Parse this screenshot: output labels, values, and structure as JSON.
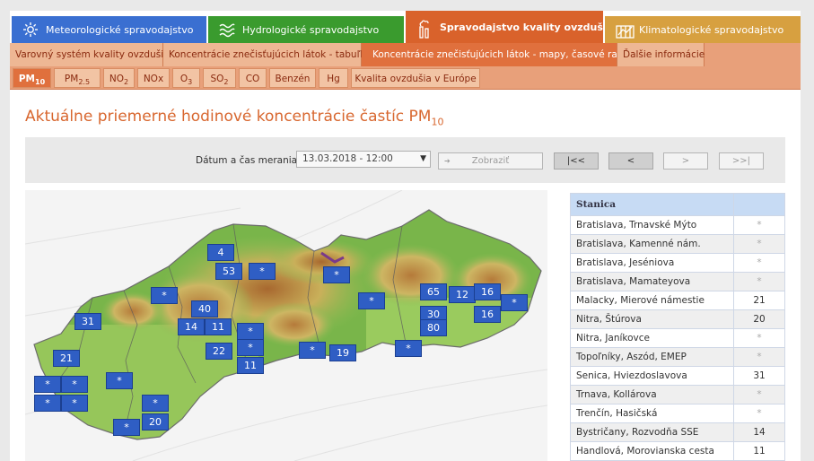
{
  "top_tabs": [
    {
      "label": "Meteorologické spravodajstvo",
      "color": "#3a6fd1",
      "icon": "sun-icon"
    },
    {
      "label": "Hydrologické spravodajstvo",
      "color": "#3a9b2e",
      "icon": "waves-icon"
    },
    {
      "label": "Spravodajstvo kvality ovzdušia",
      "color": "#d9622b",
      "icon": "smokestack-icon"
    },
    {
      "label": "Klimatologické spravodajstvo",
      "color": "#d7a040",
      "icon": "chart-icon"
    }
  ],
  "sub_nav": [
    {
      "label": "Varovný systém kvality ovzdušia"
    },
    {
      "label": "Koncentrácie znečisťujúcich látok - tabuľky"
    },
    {
      "label": "Koncentrácie znečisťujúcich látok - mapy, časové rady"
    },
    {
      "label": "Ďalšie informácie"
    }
  ],
  "pollutants": {
    "pm10": {
      "base": "PM",
      "sub": "10"
    },
    "pm25": {
      "base": "PM",
      "sub": "2.5"
    },
    "no2": {
      "base": "NO",
      "sub": "2"
    },
    "nox": {
      "base": "NOx"
    },
    "o3": {
      "base": "O",
      "sub": "3"
    },
    "so2": {
      "base": "SO",
      "sub": "2"
    },
    "co": {
      "base": "CO"
    },
    "benzen": {
      "base": "Benzén"
    },
    "hg": {
      "base": "Hg"
    },
    "europe": {
      "base": "Kvalita ovzdušia v Európe"
    }
  },
  "heading": {
    "text": "Aktuálne priemerné hodinové koncentrácie častíc PM",
    "sub": "10"
  },
  "datebar": {
    "label": "Dátum a čas merania:",
    "selected": "13.03.2018 - 12:00",
    "show_label": "Zobraziť",
    "first_label": "|<<",
    "prev_label": "<",
    "next_label": ">",
    "last_label": ">>|"
  },
  "map_markers": [
    "4",
    "53",
    "*",
    "*",
    "*",
    "*",
    "65",
    "12",
    "16",
    "*",
    "40",
    "30",
    "16",
    "31",
    "14",
    "11",
    "*",
    "80",
    "22",
    "*",
    "*",
    "19",
    "*",
    "21",
    "11",
    "*",
    "*",
    "*",
    "*",
    "*",
    "*",
    "*",
    "20"
  ],
  "table": {
    "header": [
      "Stanica",
      ""
    ],
    "rows": [
      {
        "station": "Bratislava, Trnavské Mýto",
        "value": "*"
      },
      {
        "station": "Bratislava, Kamenné nám.",
        "value": "*"
      },
      {
        "station": "Bratislava, Jeséniova",
        "value": "*"
      },
      {
        "station": "Bratislava, Mamateyova",
        "value": "*"
      },
      {
        "station": "Malacky, Mierové námestie",
        "value": "21"
      },
      {
        "station": "Nitra, Štúrova",
        "value": "20"
      },
      {
        "station": "Nitra, Janíkovce",
        "value": "*"
      },
      {
        "station": "Topoľníky, Aszód, EMEP",
        "value": "*"
      },
      {
        "station": "Senica, Hviezdoslavova",
        "value": "31"
      },
      {
        "station": "Trnava, Kollárova",
        "value": "*"
      },
      {
        "station": "Trenčín, Hasičská",
        "value": "*"
      },
      {
        "station": "Bystričany, Rozvodňa SSE",
        "value": "14"
      },
      {
        "station": "Handlová, Morovianska cesta",
        "value": "11"
      }
    ]
  }
}
